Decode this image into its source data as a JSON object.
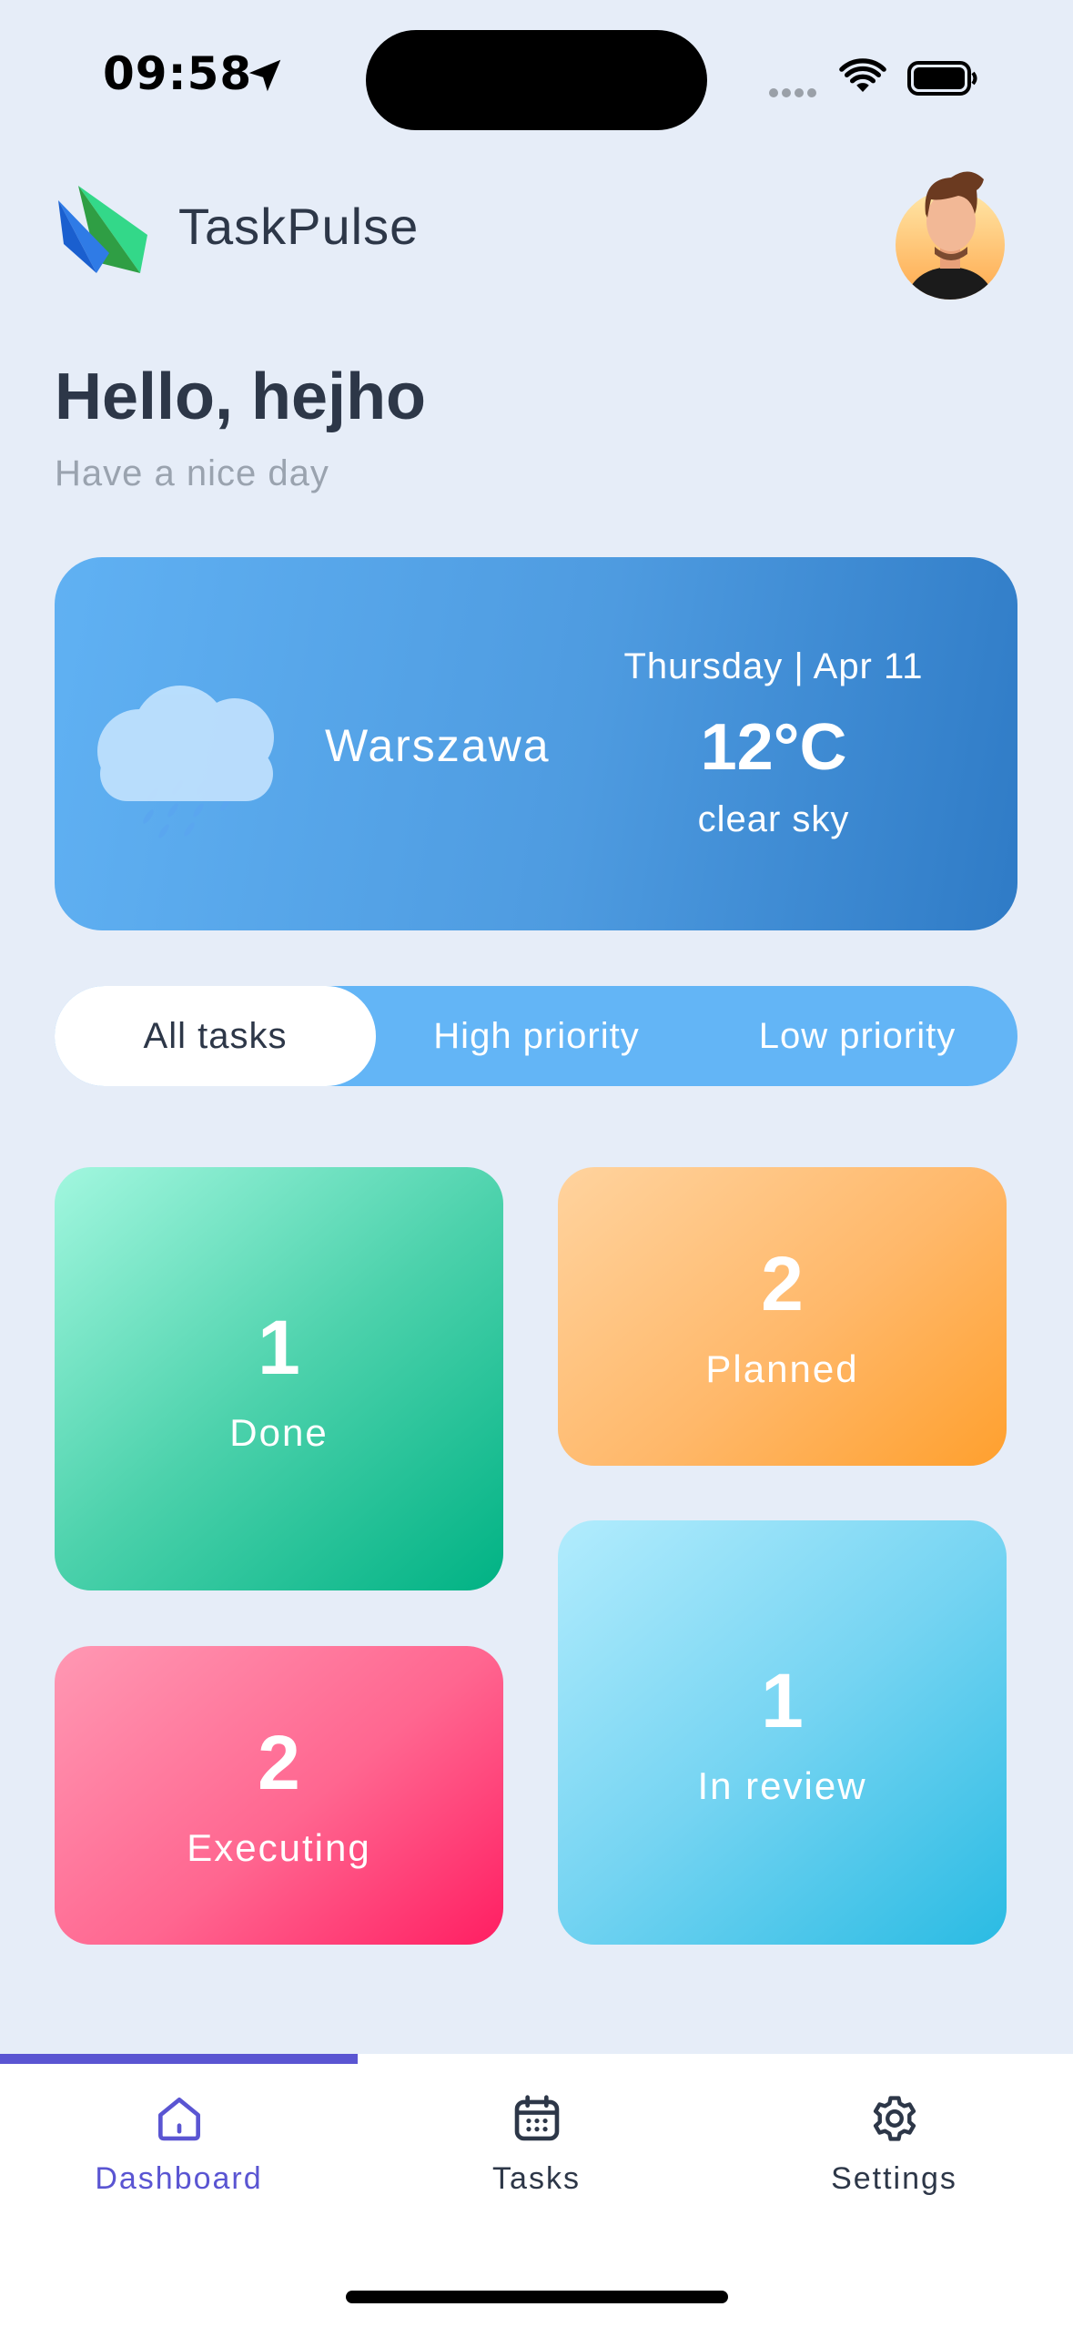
{
  "status_bar": {
    "time": "09:58"
  },
  "header": {
    "app_name": "TaskPulse"
  },
  "greeting": {
    "title": "Hello, hejho",
    "subtitle": "Have a nice day"
  },
  "weather": {
    "city": "Warszawa",
    "date": "Thursday | Apr 11",
    "temperature": "12°C",
    "description": "clear sky",
    "icon": "rain-cloud-icon"
  },
  "filter_tabs": {
    "items": [
      {
        "label": "All tasks",
        "active": true
      },
      {
        "label": "High priority",
        "active": false
      },
      {
        "label": "Low priority",
        "active": false
      }
    ]
  },
  "stats": {
    "done": {
      "count": "1",
      "label": "Done"
    },
    "planned": {
      "count": "2",
      "label": "Planned"
    },
    "executing": {
      "count": "2",
      "label": "Executing"
    },
    "in_review": {
      "count": "1",
      "label": "In review"
    }
  },
  "bottom_nav": {
    "items": [
      {
        "label": "Dashboard",
        "icon": "home-icon",
        "active": true
      },
      {
        "label": "Tasks",
        "icon": "calendar-icon",
        "active": false
      },
      {
        "label": "Settings",
        "icon": "gear-icon",
        "active": false
      }
    ]
  },
  "colors": {
    "accent": "#5a55d2",
    "background": "#e6edf8",
    "weather_card": "#4e9be0",
    "tabs_bg": "#63b5f6",
    "done": "#00b284",
    "planned": "#ffa02e",
    "executing": "#ff1e62",
    "in_review": "#2abbe3"
  }
}
